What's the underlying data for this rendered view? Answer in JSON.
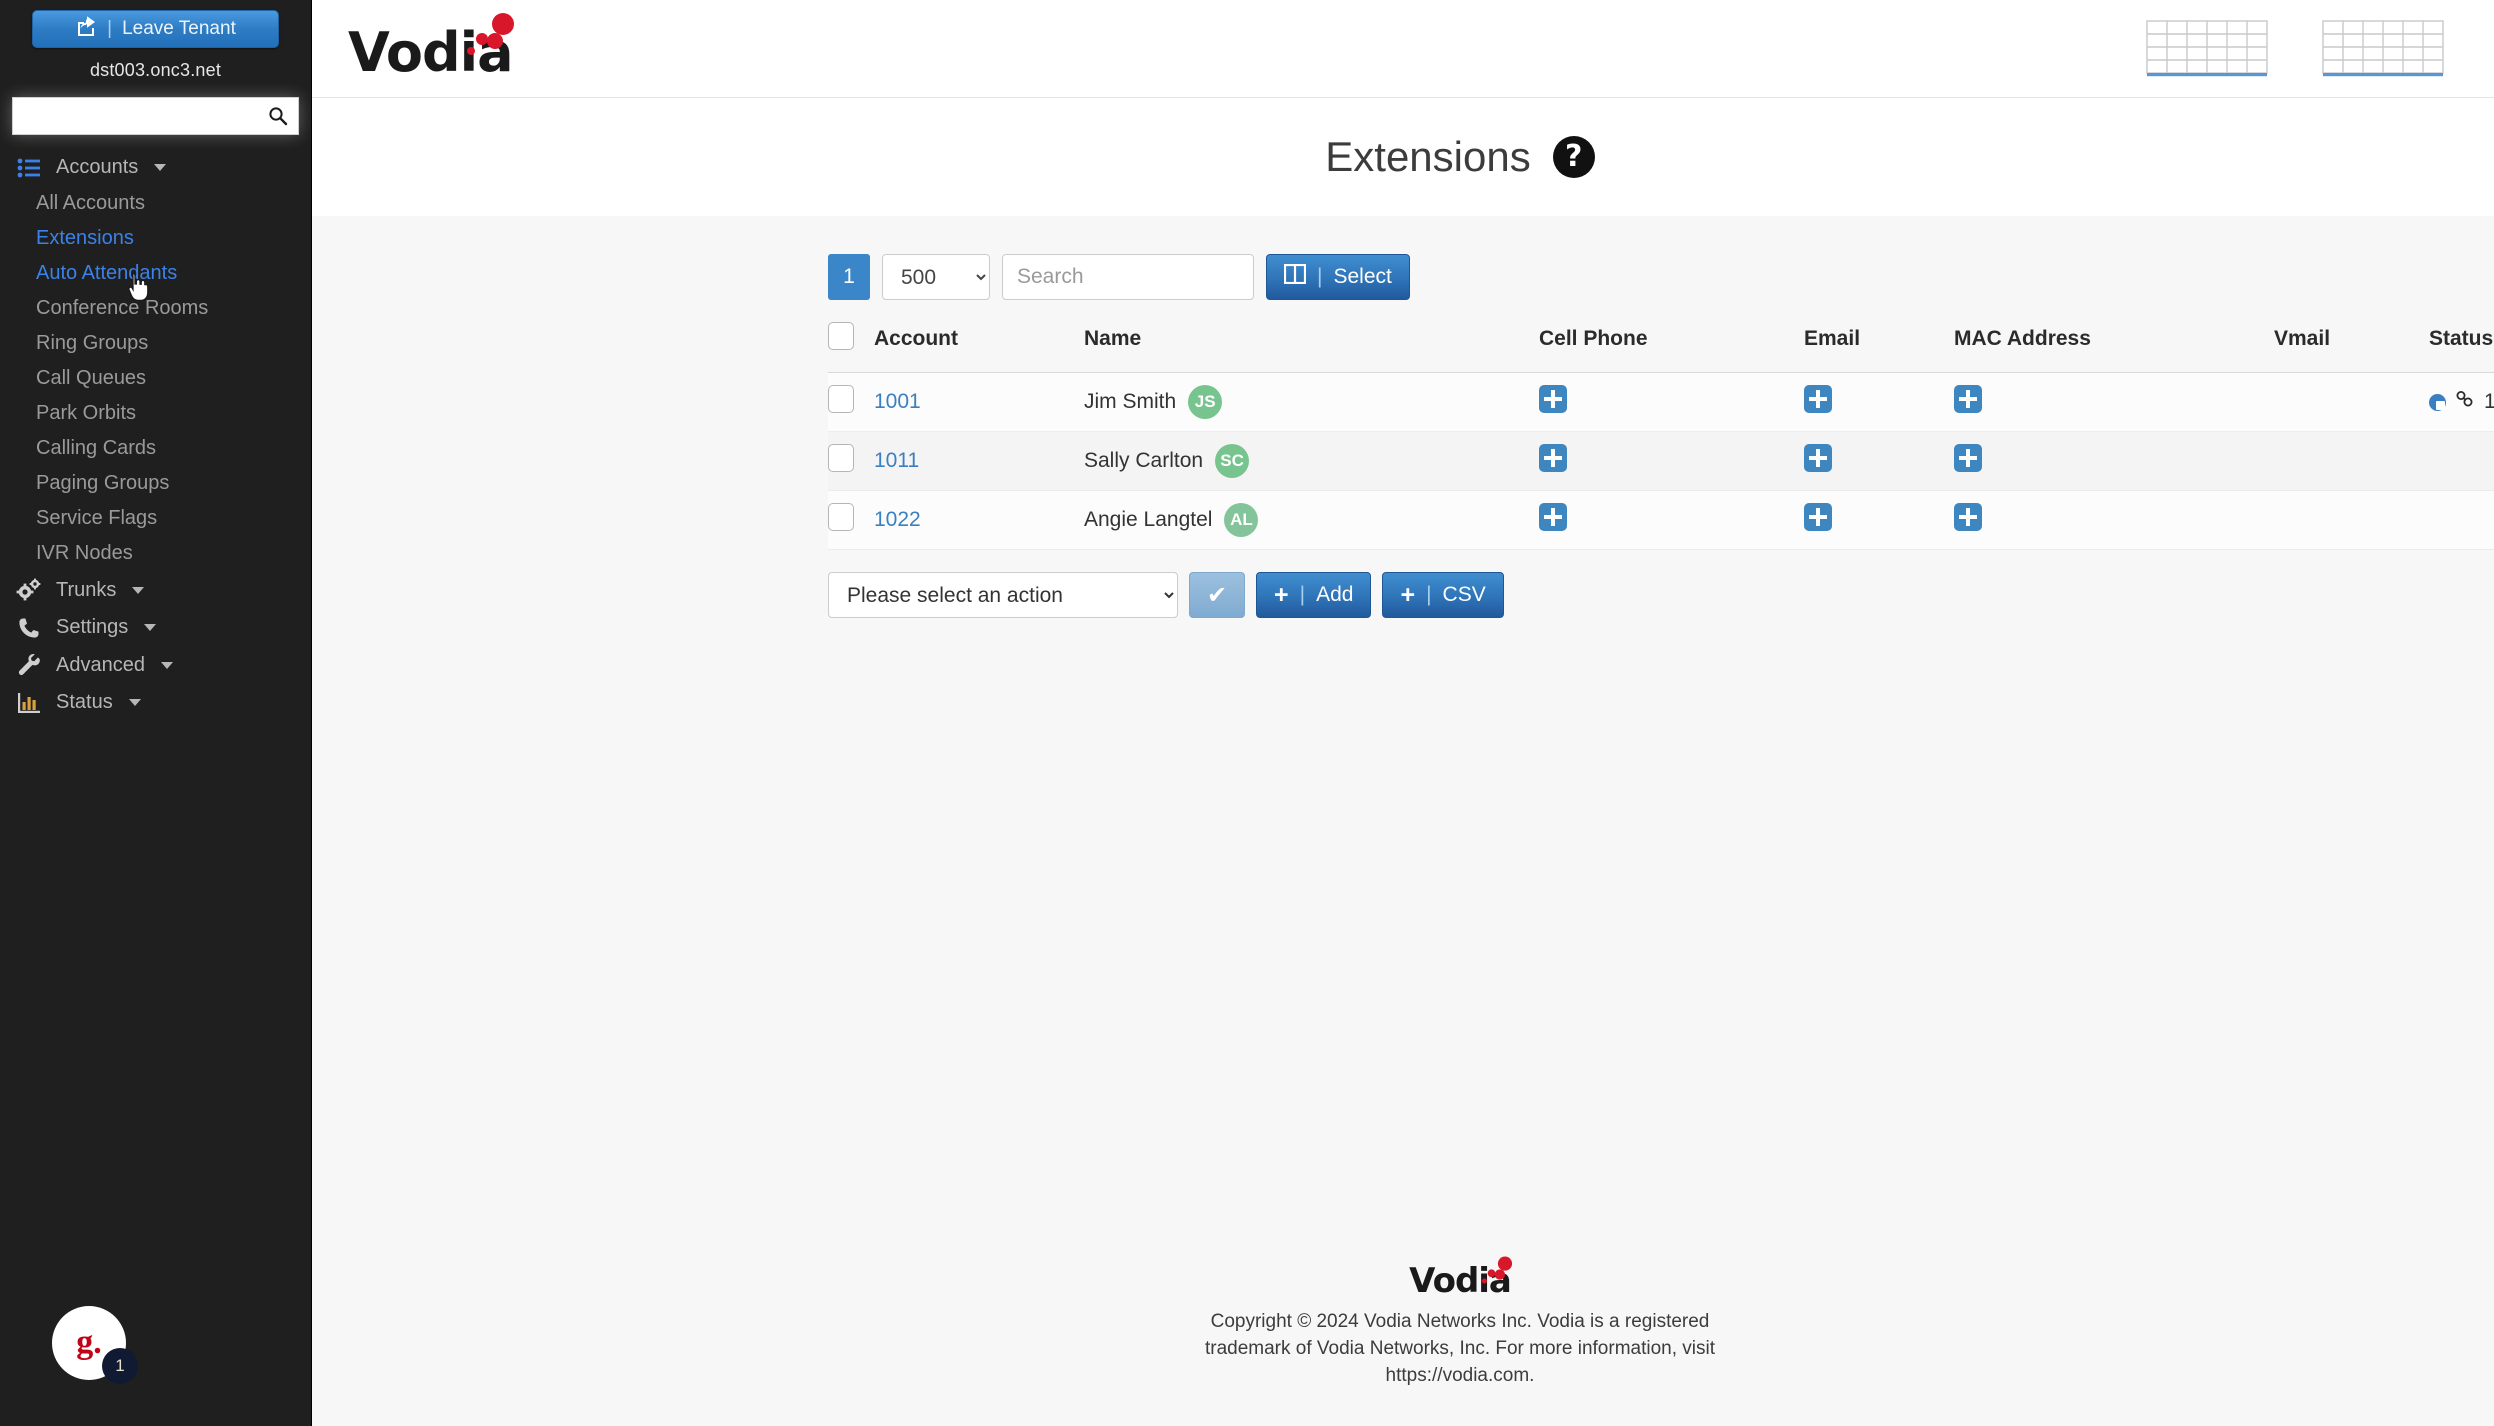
{
  "sidebar": {
    "leave_tenant": {
      "label": "Leave Tenant",
      "icon": "share-export-icon"
    },
    "tenant_host": "dst003.onc3.net",
    "search": {
      "value": "",
      "placeholder": ""
    },
    "groups": [
      {
        "label": "Accounts",
        "icon": "list-icon",
        "expanded": true,
        "items": [
          {
            "label": "All Accounts",
            "state": "normal"
          },
          {
            "label": "Extensions",
            "state": "active"
          },
          {
            "label": "Auto Attendants",
            "state": "hover"
          },
          {
            "label": "Conference Rooms",
            "state": "normal"
          },
          {
            "label": "Ring Groups",
            "state": "normal"
          },
          {
            "label": "Call Queues",
            "state": "normal"
          },
          {
            "label": "Park Orbits",
            "state": "normal"
          },
          {
            "label": "Calling Cards",
            "state": "normal"
          },
          {
            "label": "Paging Groups",
            "state": "normal"
          },
          {
            "label": "Service Flags",
            "state": "normal"
          },
          {
            "label": "IVR Nodes",
            "state": "normal"
          }
        ]
      },
      {
        "label": "Trunks",
        "icon": "gears-icon",
        "expanded": false,
        "items": []
      },
      {
        "label": "Settings",
        "icon": "phone-icon",
        "expanded": false,
        "items": []
      },
      {
        "label": "Advanced",
        "icon": "wrench-icon",
        "expanded": false,
        "items": []
      },
      {
        "label": "Status",
        "icon": "bar-chart-icon",
        "expanded": false,
        "items": []
      }
    ],
    "user": {
      "initial": "g.",
      "badge_count": "1"
    }
  },
  "topbar": {
    "logo_text": "Vodia",
    "icons": [
      {
        "name": "grid-table-icon-1"
      },
      {
        "name": "grid-table-icon-2"
      },
      {
        "name": "logout-icon"
      }
    ]
  },
  "page": {
    "title": "Extensions",
    "help_glyph": "?"
  },
  "toolbar": {
    "page_number": "1",
    "page_size": "500",
    "page_size_options": [
      "500"
    ],
    "search_value": "",
    "search_placeholder": "Search",
    "select_label": "Select"
  },
  "table": {
    "columns": [
      "Account",
      "Name",
      "Cell Phone",
      "Email",
      "MAC Address",
      "Vmail",
      "Status"
    ],
    "rows": [
      {
        "account": "1001",
        "name": "Jim Smith",
        "initials": "JS",
        "cell_phone": "add",
        "email": "add",
        "mac_address": "add",
        "vmail": "",
        "status_count": "1",
        "has_status": true
      },
      {
        "account": "1011",
        "name": "Sally Carlton",
        "initials": "SC",
        "cell_phone": "add",
        "email": "add",
        "mac_address": "add",
        "vmail": "",
        "status_count": "",
        "has_status": false
      },
      {
        "account": "1022",
        "name": "Angie Langtel",
        "initials": "AL",
        "cell_phone": "add",
        "email": "add",
        "mac_address": "add",
        "vmail": "",
        "status_count": "",
        "has_status": false
      }
    ]
  },
  "actions": {
    "select_value": "Please select an action",
    "apply_glyph": "✔",
    "add_label": "Add",
    "csv_label": "CSV",
    "plus_glyph": "+"
  },
  "footer": {
    "logo_text": "Vodia",
    "line1": "Copyright © 2024 Vodia Networks Inc. Vodia is a registered",
    "line2": "trademark of Vodia Networks, Inc. For more information, visit",
    "line3": "https://vodia.com."
  },
  "colors": {
    "accent_blue": "#3a7fc1",
    "sidebar_bg": "#1f1f1f",
    "avatar_green": "#77c48f",
    "logo_red": "#d8172a"
  }
}
